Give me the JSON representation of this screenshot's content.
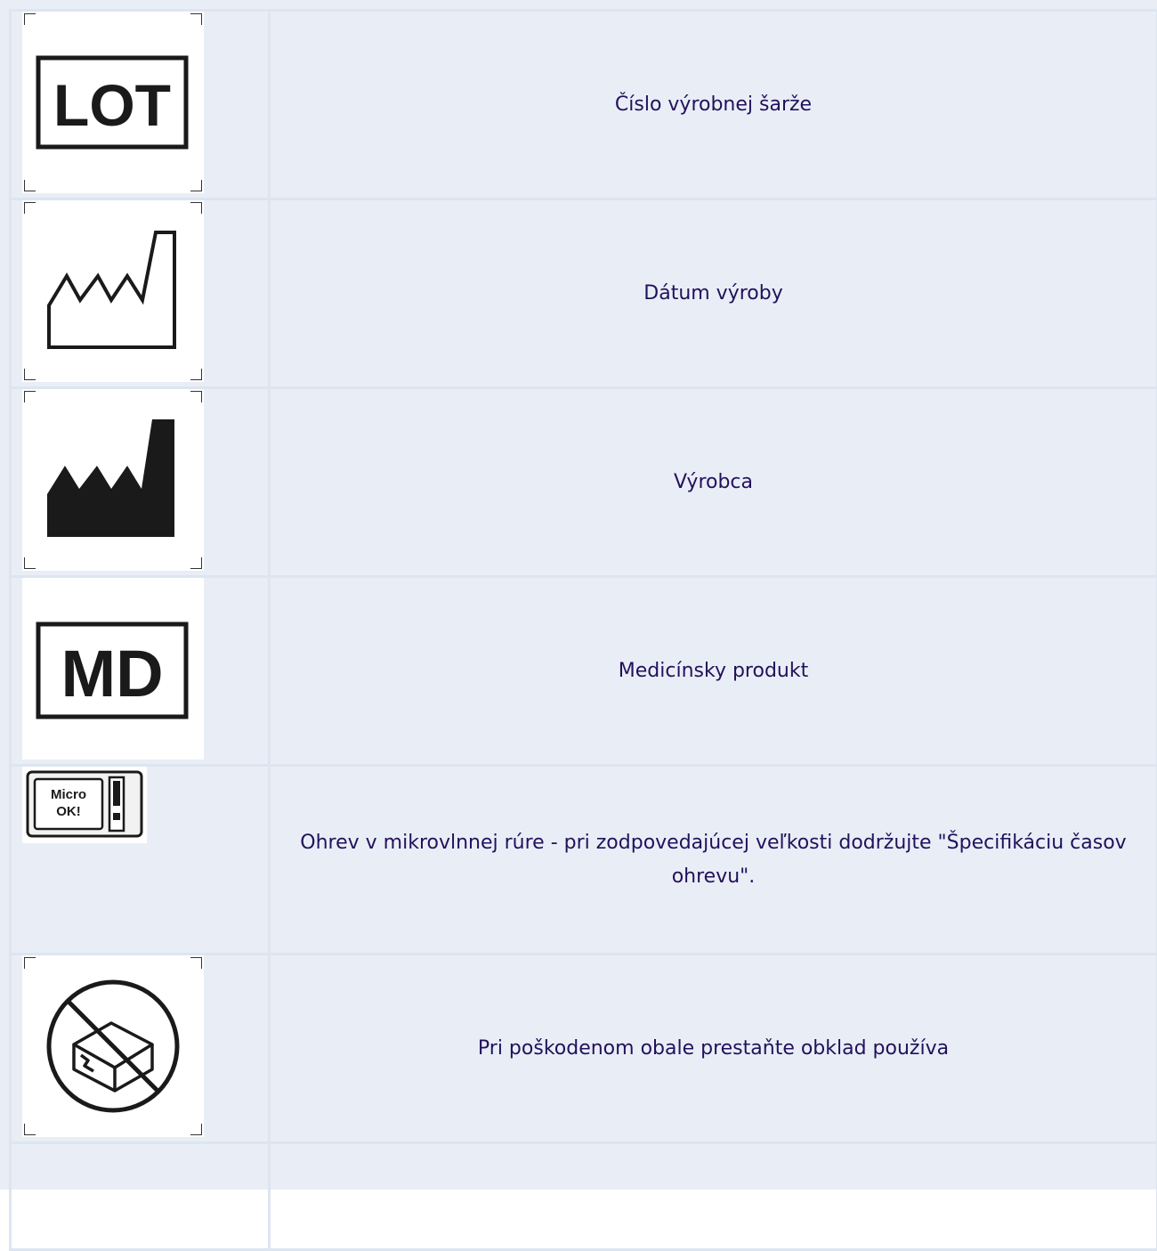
{
  "rows": [
    {
      "icon": "lot-icon",
      "icon_text": "LOT",
      "description": "Číslo výrobnej šarže"
    },
    {
      "icon": "date-of-manufacture-icon",
      "description": "Dátum výroby"
    },
    {
      "icon": "manufacturer-icon",
      "description": "Výrobca"
    },
    {
      "icon": "medical-device-icon",
      "icon_text": "MD",
      "description": "Medicínsky produkt"
    },
    {
      "icon": "microwave-ok-icon",
      "icon_text_line1": "Micro",
      "icon_text_line2": "OK!",
      "description": "Ohrev v mikrovlnnej rúre - pri zodpovedajúcej veľkosti dodržujte \"Špecifikáciu časov ohrevu\"."
    },
    {
      "icon": "do-not-use-if-damaged-icon",
      "description": "Pri poškodenom obale prestaňte obklad používa"
    },
    {
      "icon": "",
      "description": ""
    }
  ],
  "colors": {
    "text": "#22115c",
    "background": "#e9eef6",
    "grid": "#dde5f0"
  }
}
